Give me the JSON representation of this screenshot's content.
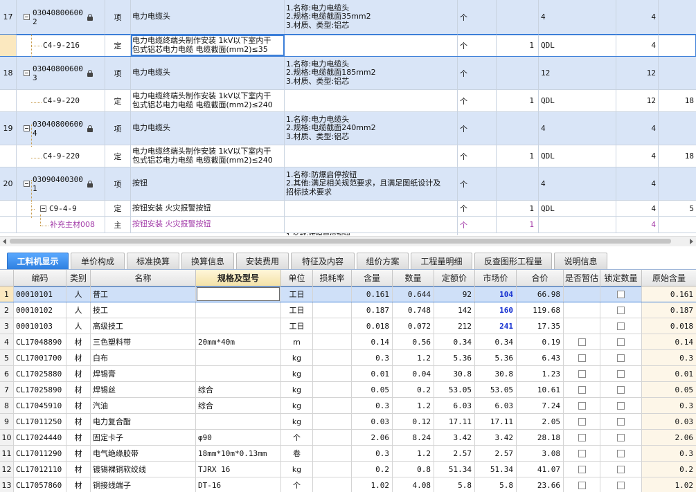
{
  "top_rows": [
    {
      "no": "17",
      "code": "03040800600\n2",
      "type": "项",
      "name": "电力电缆头",
      "features": "1.名称:电力电缆头\n2.规格:电缆截面35mm2\n3.材质、类型:铝芯",
      "unit": "个",
      "hl": "",
      "gcl": "4",
      "qty": "4",
      "x": ""
    },
    {
      "no": "",
      "code": "C4-9-216",
      "type": "定",
      "name": "电力电缆终端头制作安装 1kV以下室内干\n包式铝芯电力电缆 电缆截面(mm2)≤35",
      "features": "",
      "unit": "个",
      "hl": "1",
      "gcl": "QDL",
      "qty": "4",
      "x": ""
    },
    {
      "no": "18",
      "code": "03040800600\n3",
      "type": "项",
      "name": "电力电缆头",
      "features": "1.名称:电力电缆头\n2.规格:电缆截面185mm2\n3.材质、类型:铝芯",
      "unit": "个",
      "hl": "",
      "gcl": "12",
      "qty": "12",
      "x": ""
    },
    {
      "no": "",
      "code": "C4-9-220",
      "type": "定",
      "name": "电力电缆终端头制作安装 1kV以下室内干\n包式铝芯电力电缆 电缆截面(mm2)≤240",
      "features": "",
      "unit": "个",
      "hl": "1",
      "gcl": "QDL",
      "qty": "12",
      "x": "18"
    },
    {
      "no": "19",
      "code": "03040800600\n4",
      "type": "项",
      "name": "电力电缆头",
      "features": "1.名称:电力电缆头\n2.规格:电缆截面240mm2\n3.材质、类型:铝芯",
      "unit": "个",
      "hl": "",
      "gcl": "4",
      "qty": "4",
      "x": ""
    },
    {
      "no": "",
      "code": "C4-9-220",
      "type": "定",
      "name": "电力电缆终端头制作安装 1kV以下室内干\n包式铝芯电力电缆 电缆截面(mm2)≤240",
      "features": "",
      "unit": "个",
      "hl": "1",
      "gcl": "QDL",
      "qty": "4",
      "x": "18"
    },
    {
      "no": "20",
      "code": "03090400300\n1",
      "type": "项",
      "name": "按钮",
      "features": "1.名称:防爆启停按钮\n2.其他:满足相关规范要求，且满足图纸设计及\n招标技术要求",
      "unit": "个",
      "hl": "",
      "gcl": "4",
      "qty": "4",
      "x": ""
    },
    {
      "no": "",
      "code": "C9-4-9",
      "type": "定",
      "name": "按钮安装 火灾报警按钮",
      "features": "",
      "unit": "个",
      "hl": "1",
      "gcl": "QDL",
      "qty": "4",
      "x": "5"
    },
    {
      "no": "",
      "code": "补充主材008",
      "type": "主",
      "name": "按钮安装 火灾报警按钮",
      "features": "",
      "unit": "个",
      "hl": "1",
      "gcl": "",
      "qty": "4",
      "x": ""
    }
  ],
  "top_partial_text": "1.名称:防爆启停按钮",
  "tabs": [
    "工料机显示",
    "单价构成",
    "标准换算",
    "换算信息",
    "安装费用",
    "特征及内容",
    "组价方案",
    "工程量明细",
    "反查图形工程量",
    "说明信息"
  ],
  "headers": {
    "code": "编码",
    "cat": "类别",
    "name": "名称",
    "spec": "规格及型号",
    "unit": "单位",
    "loss": "损耗率",
    "han": "含量",
    "qty": "数量",
    "dep": "定额价",
    "mkt": "市场价",
    "sum": "合价",
    "est": "是否暂估",
    "lock": "锁定数量",
    "orig": "原始含量"
  },
  "bottom_rows": [
    {
      "no": "1",
      "code": "00010101",
      "cat": "人",
      "name": "普工",
      "spec": "",
      "unit": "工日",
      "loss": "",
      "han": "0.161",
      "qty": "0.644",
      "dep": "92",
      "mkt": "104",
      "sum": "66.98",
      "est": false,
      "lock": true,
      "orig": "0.161",
      "mktBlue": true
    },
    {
      "no": "2",
      "code": "00010102",
      "cat": "人",
      "name": "技工",
      "spec": "",
      "unit": "工日",
      "loss": "",
      "han": "0.187",
      "qty": "0.748",
      "dep": "142",
      "mkt": "160",
      "sum": "119.68",
      "est": false,
      "lock": true,
      "orig": "0.187",
      "mktBlue": true
    },
    {
      "no": "3",
      "code": "00010103",
      "cat": "人",
      "name": "高级技工",
      "spec": "",
      "unit": "工日",
      "loss": "",
      "han": "0.018",
      "qty": "0.072",
      "dep": "212",
      "mkt": "241",
      "sum": "17.35",
      "est": false,
      "lock": true,
      "orig": "0.018",
      "mktBlue": true
    },
    {
      "no": "4",
      "code": "CL17048890",
      "cat": "材",
      "name": "三色塑料带",
      "spec": "20mm*40m",
      "unit": "m",
      "loss": "",
      "han": "0.14",
      "qty": "0.56",
      "dep": "0.34",
      "mkt": "0.34",
      "sum": "0.19",
      "est": true,
      "lock": true,
      "orig": "0.14",
      "mktBlue": false
    },
    {
      "no": "5",
      "code": "CL17001700",
      "cat": "材",
      "name": "白布",
      "spec": "",
      "unit": "kg",
      "loss": "",
      "han": "0.3",
      "qty": "1.2",
      "dep": "5.36",
      "mkt": "5.36",
      "sum": "6.43",
      "est": true,
      "lock": true,
      "orig": "0.3",
      "mktBlue": false
    },
    {
      "no": "6",
      "code": "CL17025880",
      "cat": "材",
      "name": "焊锡膏",
      "spec": "",
      "unit": "kg",
      "loss": "",
      "han": "0.01",
      "qty": "0.04",
      "dep": "30.8",
      "mkt": "30.8",
      "sum": "1.23",
      "est": true,
      "lock": true,
      "orig": "0.01",
      "mktBlue": false
    },
    {
      "no": "7",
      "code": "CL17025890",
      "cat": "材",
      "name": "焊锡丝",
      "spec": "综合",
      "unit": "kg",
      "loss": "",
      "han": "0.05",
      "qty": "0.2",
      "dep": "53.05",
      "mkt": "53.05",
      "sum": "10.61",
      "est": true,
      "lock": true,
      "orig": "0.05",
      "mktBlue": false
    },
    {
      "no": "8",
      "code": "CL17045910",
      "cat": "材",
      "name": "汽油",
      "spec": "综合",
      "unit": "kg",
      "loss": "",
      "han": "0.3",
      "qty": "1.2",
      "dep": "6.03",
      "mkt": "6.03",
      "sum": "7.24",
      "est": true,
      "lock": true,
      "orig": "0.3",
      "mktBlue": false
    },
    {
      "no": "9",
      "code": "CL17011250",
      "cat": "材",
      "name": "电力复合酯",
      "spec": "",
      "unit": "kg",
      "loss": "",
      "han": "0.03",
      "qty": "0.12",
      "dep": "17.11",
      "mkt": "17.11",
      "sum": "2.05",
      "est": true,
      "lock": true,
      "orig": "0.03",
      "mktBlue": false
    },
    {
      "no": "10",
      "code": "CL17024440",
      "cat": "材",
      "name": "固定卡子",
      "spec": "φ90",
      "unit": "个",
      "loss": "",
      "han": "2.06",
      "qty": "8.24",
      "dep": "3.42",
      "mkt": "3.42",
      "sum": "28.18",
      "est": true,
      "lock": true,
      "orig": "2.06",
      "mktBlue": false
    },
    {
      "no": "11",
      "code": "CL17011290",
      "cat": "材",
      "name": "电气绝缘胶带",
      "spec": "18mm*10m*0.13mm",
      "unit": "卷",
      "loss": "",
      "han": "0.3",
      "qty": "1.2",
      "dep": "2.57",
      "mkt": "2.57",
      "sum": "3.08",
      "est": true,
      "lock": true,
      "orig": "0.3",
      "mktBlue": false
    },
    {
      "no": "12",
      "code": "CL17012110",
      "cat": "材",
      "name": "镀锡裸铜软绞线",
      "spec": "TJRX 16",
      "unit": "kg",
      "loss": "",
      "han": "0.2",
      "qty": "0.8",
      "dep": "51.34",
      "mkt": "51.34",
      "sum": "41.07",
      "est": true,
      "lock": true,
      "orig": "0.2",
      "mktBlue": false
    },
    {
      "no": "13",
      "code": "CL17057860",
      "cat": "材",
      "name": "铜接线端子",
      "spec": "DT-16",
      "unit": "个",
      "loss": "",
      "han": "1.02",
      "qty": "4.08",
      "dep": "5.8",
      "mkt": "5.8",
      "sum": "23.66",
      "est": true,
      "lock": true,
      "orig": "1.02",
      "mktBlue": false
    }
  ],
  "colors": {
    "active_tab": "#2e7fe0",
    "blue_price": "#1530d0",
    "purple": "#a23aa8",
    "qd_row": "#d9e5f7"
  }
}
